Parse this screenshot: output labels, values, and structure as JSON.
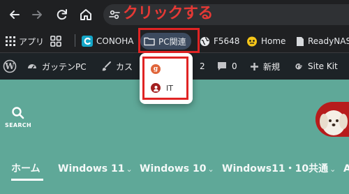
{
  "annotation": {
    "click_label": "クリックする",
    "color": "#e02424"
  },
  "bookmarks": [
    {
      "label": "アプリ",
      "icon": "apps-grid-icon"
    },
    {
      "label": "",
      "icon": "tab-groups-icon"
    },
    {
      "label": "CONOHA",
      "icon": "conoha-icon"
    },
    {
      "label": "PC関連",
      "icon": "folder-icon"
    },
    {
      "label": "F5648",
      "icon": "globe-icon"
    },
    {
      "label": "Home",
      "icon": "home-assistant-icon"
    },
    {
      "label": "ReadyNAS",
      "icon": "page-icon"
    }
  ],
  "wp_admin": {
    "site_name": "ガッテンPC",
    "customize": "カス",
    "updates": "2",
    "comments": "0",
    "new": "新規",
    "site_kit": "Site Kit"
  },
  "dropdown": {
    "items": [
      {
        "label": "",
        "icon": "g-favicon-icon"
      },
      {
        "label": "IT",
        "icon": "it-favicon-icon"
      }
    ]
  },
  "site": {
    "search_label": "SEARCH",
    "nav": [
      "ホーム",
      "Windows 11",
      "Windows 10",
      "Windows11・10共通",
      "A"
    ]
  },
  "colors": {
    "toolbar": "#1f2022",
    "wpbar": "#1d2327",
    "site_bg": "#5fa898",
    "folder_highlight": "#3c4a5e"
  }
}
